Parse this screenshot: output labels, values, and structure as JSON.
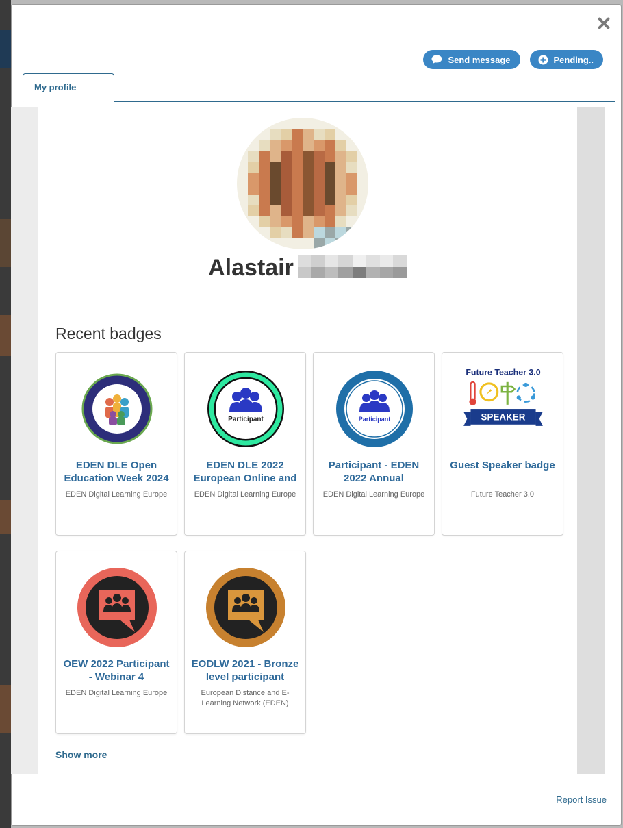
{
  "modal": {
    "close_icon": "close-icon"
  },
  "actions": {
    "send_message": "Send message",
    "pending": "Pending.."
  },
  "tabs": [
    {
      "label": "My profile"
    }
  ],
  "profile": {
    "name": "Alastair"
  },
  "badges": {
    "title": "Recent badges",
    "items": [
      {
        "title": "EDEN DLE Open Education Week 2024",
        "issuer": "EDEN Digital Learning Europe",
        "icon": "open-education-week-badge"
      },
      {
        "title": "EDEN DLE 2022 European Online and",
        "issuer": "EDEN Digital Learning Europe",
        "icon": "participant-badge",
        "badge_text": "Participant"
      },
      {
        "title": "Participant - EDEN 2022 Annual",
        "issuer": "EDEN Digital Learning Europe",
        "icon": "annual-conference-badge",
        "badge_text": "Participant"
      },
      {
        "title": "Guest Speaker badge",
        "issuer": "Future Teacher 3.0",
        "icon": "speaker-badge",
        "badge_heading": "Future Teacher 3.0",
        "badge_text": "SPEAKER"
      },
      {
        "title": "OEW 2022 Participant - Webinar 4",
        "issuer": "EDEN Digital Learning Europe",
        "icon": "garden-of-learning-red-badge"
      },
      {
        "title": "EODLW 2021 - Bronze level participant",
        "issuer": "European Distance and E-Learning Network (EDEN)",
        "icon": "garden-of-learning-bronze-badge"
      }
    ],
    "show_more": "Show more"
  },
  "footer": {
    "report_issue": "Report Issue"
  },
  "colors": {
    "accent": "#3a86c5",
    "link": "#2f6a9a"
  }
}
